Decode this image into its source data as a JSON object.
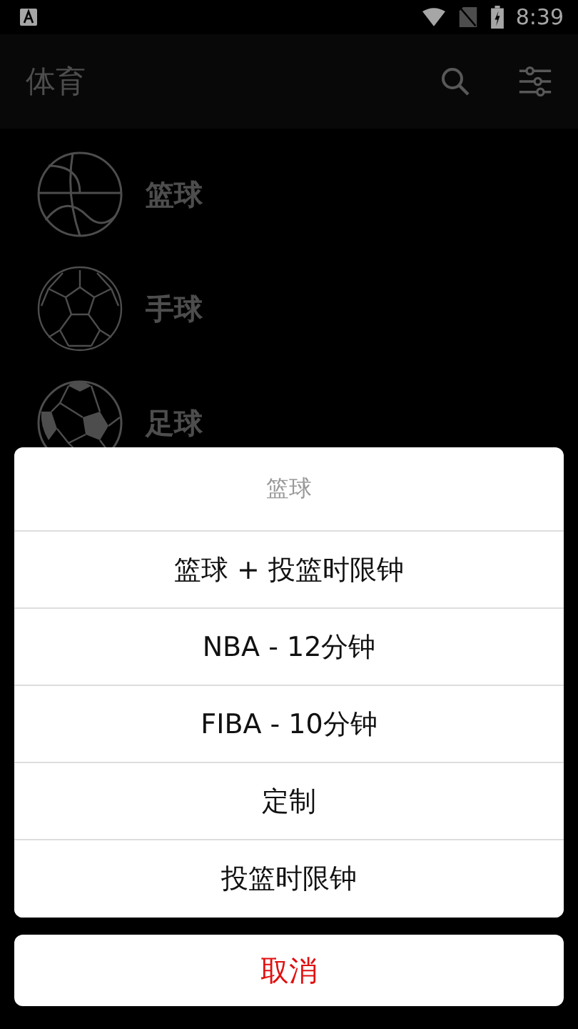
{
  "status_bar": {
    "time": "8:39"
  },
  "app_bar": {
    "title": "体育"
  },
  "sports": [
    {
      "kind": "basketball",
      "label": "篮球"
    },
    {
      "kind": "handball",
      "label": "手球"
    },
    {
      "kind": "soccer",
      "label": "足球"
    }
  ],
  "dialog": {
    "title": "篮球",
    "options": [
      "篮球 + 投篮时限钟",
      "NBA - 12分钟",
      "FIBA - 10分钟",
      "定制",
      "投篮时限钟"
    ],
    "cancel": "取消"
  }
}
